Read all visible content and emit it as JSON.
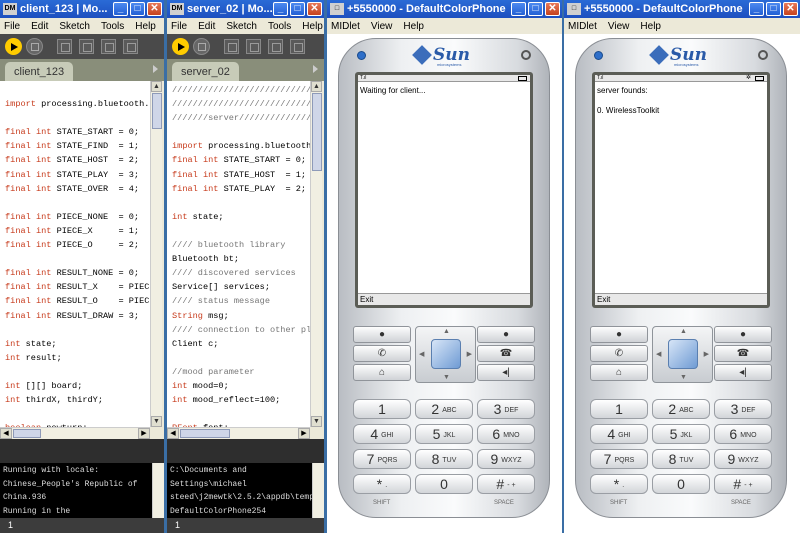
{
  "windows": {
    "client": {
      "title": "client_123 | Mo...",
      "menu": [
        "File",
        "Edit",
        "Sketch",
        "Tools",
        "Help"
      ],
      "tab": "client_123",
      "code": [
        [
          ""
        ],
        [
          [
            "kw",
            "import"
          ],
          [
            "",
            "processing.bluetooth.*;"
          ]
        ],
        [
          ""
        ],
        [
          [
            "kw",
            "final int"
          ],
          [
            "",
            "STATE_START = 0;"
          ]
        ],
        [
          [
            "kw",
            "final int"
          ],
          [
            "",
            "STATE_FIND  = 1;"
          ]
        ],
        [
          [
            "kw",
            "final int"
          ],
          [
            "",
            "STATE_HOST  = 2;"
          ]
        ],
        [
          [
            "kw",
            "final int"
          ],
          [
            "",
            "STATE_PLAY  = 3;"
          ]
        ],
        [
          [
            "kw",
            "final int"
          ],
          [
            "",
            "STATE_OVER  = 4;"
          ]
        ],
        [
          ""
        ],
        [
          [
            "kw",
            "final int"
          ],
          [
            "",
            "PIECE_NONE  = 0;"
          ]
        ],
        [
          [
            "kw",
            "final int"
          ],
          [
            "",
            "PIECE_X     = 1;"
          ]
        ],
        [
          [
            "kw",
            "final int"
          ],
          [
            "",
            "PIECE_O     = 2;"
          ]
        ],
        [
          ""
        ],
        [
          [
            "kw",
            "final int"
          ],
          [
            "",
            "RESULT_NONE = 0;"
          ]
        ],
        [
          [
            "kw",
            "final int"
          ],
          [
            "",
            "RESULT_X    = PIECE_X;"
          ]
        ],
        [
          [
            "kw",
            "final int"
          ],
          [
            "",
            "RESULT_O    = PIECE_O;"
          ]
        ],
        [
          [
            "kw",
            "final int"
          ],
          [
            "",
            "RESULT_DRAW = 3;"
          ]
        ],
        [
          ""
        ],
        [
          [
            "kw",
            "int"
          ],
          [
            "",
            "state;"
          ]
        ],
        [
          [
            "kw",
            "int"
          ],
          [
            "",
            "result;"
          ]
        ],
        [
          ""
        ],
        [
          [
            "kw",
            "int"
          ],
          [
            "",
            "[][] board;"
          ]
        ],
        [
          [
            "kw",
            "int"
          ],
          [
            "",
            "thirdX, thirdY;"
          ]
        ],
        [
          ""
        ],
        [
          [
            "kw",
            "boolean"
          ],
          [
            "",
            "newturn;"
          ]
        ]
      ],
      "console": [
        "Running with locale:",
        "Chinese_People's Republic of",
        "China.936",
        "Running in the"
      ],
      "footer": "1"
    },
    "server": {
      "title": "server_02 | Mo...",
      "menu": [
        "File",
        "Edit",
        "Sketch",
        "Tools",
        "Help"
      ],
      "tab": "server_02",
      "code": [
        [
          [
            "cm",
            "////////////////////////////"
          ]
        ],
        [
          [
            "cm",
            "////////////////////////////"
          ]
        ],
        [
          [
            "cm",
            "///////server//////////////"
          ]
        ],
        [
          ""
        ],
        [
          [
            "kw",
            "import"
          ],
          [
            "",
            "processing.bluetooth.*;"
          ]
        ],
        [
          [
            "kw",
            "final int"
          ],
          [
            "",
            "STATE_START = 0;"
          ]
        ],
        [
          [
            "kw",
            "final int"
          ],
          [
            "",
            "STATE_HOST  = 1;"
          ]
        ],
        [
          [
            "kw",
            "final int"
          ],
          [
            "",
            "STATE_PLAY  = 2;"
          ]
        ],
        [
          ""
        ],
        [
          [
            "kw",
            "int"
          ],
          [
            "",
            "state;"
          ]
        ],
        [
          ""
        ],
        [
          [
            "cm",
            "//// bluetooth library"
          ]
        ],
        [
          [
            "",
            "Bluetooth bt;"
          ]
        ],
        [
          [
            "cm",
            "//// discovered services"
          ]
        ],
        [
          [
            "",
            "Service[] services;"
          ]
        ],
        [
          [
            "cm",
            "//// status message"
          ]
        ],
        [
          [
            "kw",
            "String"
          ],
          [
            "",
            "msg;"
          ]
        ],
        [
          [
            "cm",
            "//// connection to other player"
          ]
        ],
        [
          [
            "",
            "Client c;"
          ]
        ],
        [
          ""
        ],
        [
          [
            "cm",
            "//mood parameter"
          ]
        ],
        [
          [
            "kw",
            "int"
          ],
          [
            "",
            "mood=0;"
          ]
        ],
        [
          [
            "kw",
            "int"
          ],
          [
            "",
            "mood_reflect=100;"
          ]
        ],
        [
          ""
        ],
        [
          [
            "kw",
            "PFont"
          ],
          [
            "",
            "font;"
          ]
        ]
      ],
      "console": [
        "C:\\Documents and",
        "Settings\\michael",
        "steed\\j2mewtk\\2.5.2\\appdb\\temp",
        "DefaultColorPhone254"
      ],
      "footer": "1"
    },
    "phone1": {
      "title": "+5550000 - DefaultColorPhone",
      "menu": [
        "MIDlet",
        "View",
        "Help"
      ],
      "screen_text": "Waiting for client...",
      "soft_left": "Exit"
    },
    "phone2": {
      "title": "+5550000 - DefaultColorPhone",
      "menu": [
        "MIDlet",
        "View",
        "Help"
      ],
      "screen_text": "server founds:\n\n0. WirelessToolkit",
      "soft_left": "Exit"
    }
  },
  "phone_common": {
    "logo": "Sun",
    "logo_sub": "microsystems",
    "signal": "T.ıl",
    "keys": [
      {
        "num": "1",
        "let": ""
      },
      {
        "num": "2",
        "let": "ABC"
      },
      {
        "num": "3",
        "let": "DEF"
      },
      {
        "num": "4",
        "let": "GHI"
      },
      {
        "num": "5",
        "let": "JKL"
      },
      {
        "num": "6",
        "let": "MNO"
      },
      {
        "num": "7",
        "let": "PQRS"
      },
      {
        "num": "8",
        "let": "TUV"
      },
      {
        "num": "9",
        "let": "WXYZ"
      },
      {
        "num": "*",
        "let": "."
      },
      {
        "num": "0",
        "let": ""
      },
      {
        "num": "#",
        "let": "- +"
      }
    ],
    "shift_label": "SHIFT",
    "space_label": "SPACE"
  },
  "colors": {
    "accent": "#ffcc00",
    "titlebar": "#2a6bd6"
  }
}
